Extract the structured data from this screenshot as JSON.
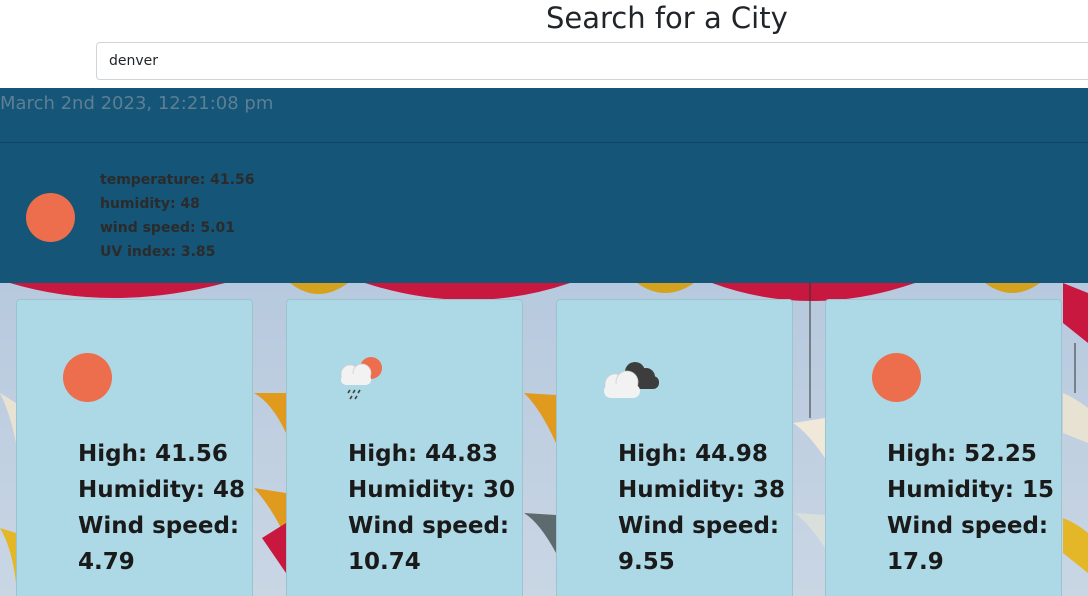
{
  "search": {
    "title": "Search for a City",
    "value": "denver"
  },
  "current": {
    "datetime": "March 2nd 2023, 12:21:08 pm",
    "icon": "sun-icon",
    "temperature": "temperature: 41.56",
    "humidity": "humidity: 48",
    "wind": "wind speed: 5.01",
    "uv": "UV index: 3.85"
  },
  "forecast": [
    {
      "icon": "sun-icon",
      "high": "High: 41.56",
      "humidity": "Humidity: 48",
      "wind_label": "Wind speed:",
      "wind_value": "4.79"
    },
    {
      "icon": "rain-cloud-sun-icon",
      "high": "High: 44.83",
      "humidity": "Humidity: 30",
      "wind_label": "Wind speed:",
      "wind_value": "10.74"
    },
    {
      "icon": "cloudy-icon",
      "high": "High: 44.98",
      "humidity": "Humidity: 38",
      "wind_label": "Wind speed:",
      "wind_value": "9.55"
    },
    {
      "icon": "sun-icon",
      "high": "High: 52.25",
      "humidity": "Humidity: 15",
      "wind_label": "Wind speed:",
      "wind_value": "17.9"
    }
  ],
  "colors": {
    "panel": "#145578",
    "card": "#add8e6",
    "sun": "#ec6e4c"
  }
}
